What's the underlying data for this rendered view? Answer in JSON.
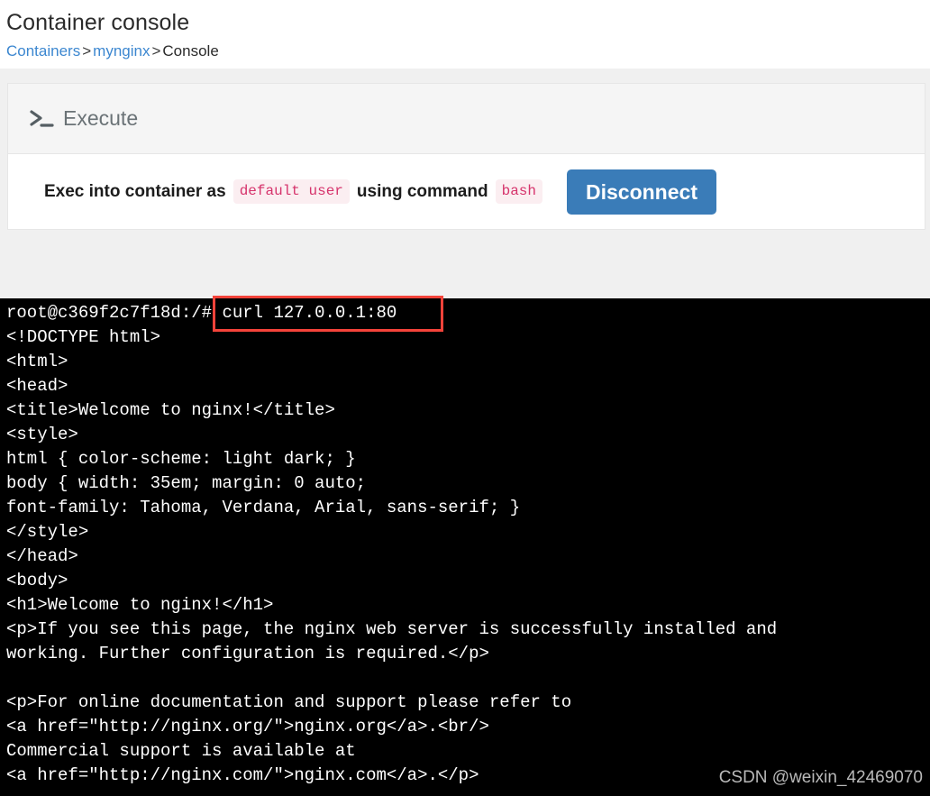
{
  "header": {
    "title": "Container console",
    "breadcrumb": {
      "item1": "Containers",
      "sep1": ">",
      "item2": "mynginx",
      "sep2": ">",
      "current": "Console"
    }
  },
  "card": {
    "header_title": "Execute",
    "header_icon": "terminal-prompt-icon",
    "exec": {
      "text_before": "Exec into container as",
      "user_badge": "default user",
      "text_middle": "using command",
      "command_badge": "bash",
      "disconnect_label": "Disconnect"
    }
  },
  "terminal": {
    "prompt": "root@c369f2c7f18d:/#",
    "command": "curl 127.0.0.1:80",
    "highlight_color": "#f4433a",
    "lines": [
      "<!DOCTYPE html>",
      "<html>",
      "<head>",
      "<title>Welcome to nginx!</title>",
      "<style>",
      "html { color-scheme: light dark; }",
      "body { width: 35em; margin: 0 auto;",
      "font-family: Tahoma, Verdana, Arial, sans-serif; }",
      "</style>",
      "</head>",
      "<body>",
      "<h1>Welcome to nginx!</h1>",
      "<p>If you see this page, the nginx web server is successfully installed and",
      "working. Further configuration is required.</p>",
      "",
      "<p>For online documentation and support please refer to",
      "<a href=\"http://nginx.org/\">nginx.org</a>.<br/>",
      "Commercial support is available at",
      "<a href=\"http://nginx.com/\">nginx.com</a>.</p>"
    ]
  },
  "watermark": "CSDN @weixin_42469070",
  "colors": {
    "accent_blue": "#3a7cb8",
    "link_blue": "#3c87d0",
    "badge_text": "#d6336c",
    "badge_bg": "#fbeef1",
    "page_bg": "#f0f0f0",
    "card_header_bg": "#f5f5f5",
    "terminal_bg": "#000000"
  }
}
